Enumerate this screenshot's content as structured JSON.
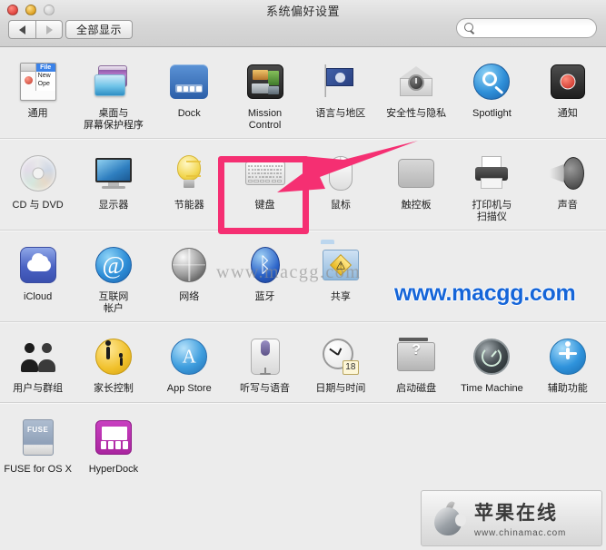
{
  "window": {
    "title": "系统偏好设置",
    "traffic_lights": [
      "close",
      "minimize",
      "zoom"
    ]
  },
  "toolbar": {
    "back_label": "◀",
    "forward_label": "▶",
    "show_all_label": "全部显示",
    "search": {
      "value": "",
      "placeholder": "",
      "icon": "search-icon"
    }
  },
  "rows": [
    {
      "cells": [
        {
          "label": "通用",
          "icon": "general-icon"
        },
        {
          "label": "桌面与\n屏幕保护程序",
          "icon": "desktop-screensaver-icon"
        },
        {
          "label": "Dock",
          "icon": "dock-icon"
        },
        {
          "label": "Mission\nControl",
          "icon": "mission-control-icon"
        },
        {
          "label": "语言与地区",
          "icon": "language-region-icon"
        },
        {
          "label": "安全性与隐私",
          "icon": "security-privacy-icon"
        },
        {
          "label": "Spotlight",
          "icon": "spotlight-icon"
        },
        {
          "label": "通知",
          "icon": "notifications-icon"
        }
      ]
    },
    {
      "cells": [
        {
          "label": "CD 与 DVD",
          "icon": "cd-dvd-icon"
        },
        {
          "label": "显示器",
          "icon": "displays-icon"
        },
        {
          "label": "节能器",
          "icon": "energy-saver-icon"
        },
        {
          "label": "键盘",
          "icon": "keyboard-icon"
        },
        {
          "label": "鼠标",
          "icon": "mouse-icon"
        },
        {
          "label": "触控板",
          "icon": "trackpad-icon"
        },
        {
          "label": "打印机与\n扫描仪",
          "icon": "printers-scanners-icon"
        },
        {
          "label": "声音",
          "icon": "sound-icon"
        }
      ]
    },
    {
      "cells": [
        {
          "label": "iCloud",
          "icon": "icloud-icon"
        },
        {
          "label": "互联网\n帐户",
          "icon": "internet-accounts-icon"
        },
        {
          "label": "网络",
          "icon": "network-icon"
        },
        {
          "label": "蓝牙",
          "icon": "bluetooth-icon"
        },
        {
          "label": "共享",
          "icon": "sharing-icon"
        },
        {
          "label": "",
          "icon": ""
        },
        {
          "label": "",
          "icon": ""
        },
        {
          "label": "",
          "icon": ""
        }
      ]
    },
    {
      "cells": [
        {
          "label": "用户与群组",
          "icon": "users-groups-icon"
        },
        {
          "label": "家长控制",
          "icon": "parental-controls-icon"
        },
        {
          "label": "App Store",
          "icon": "app-store-icon"
        },
        {
          "label": "听写与语音",
          "icon": "dictation-speech-icon"
        },
        {
          "label": "日期与时间",
          "icon": "date-time-icon"
        },
        {
          "label": "启动磁盘",
          "icon": "startup-disk-icon"
        },
        {
          "label": "Time Machine",
          "icon": "time-machine-icon"
        },
        {
          "label": "辅助功能",
          "icon": "accessibility-icon"
        }
      ]
    },
    {
      "cells": [
        {
          "label": "FUSE for OS X",
          "icon": "fuse-icon"
        },
        {
          "label": "HyperDock",
          "icon": "hyperdock-icon"
        },
        {
          "label": "",
          "icon": ""
        },
        {
          "label": "",
          "icon": ""
        },
        {
          "label": "",
          "icon": ""
        },
        {
          "label": "",
          "icon": ""
        },
        {
          "label": "",
          "icon": ""
        },
        {
          "label": "",
          "icon": ""
        }
      ]
    }
  ],
  "icon_text": {
    "general_menu_title": "File",
    "general_menu_item1": "New",
    "general_menu_item2": "Ope",
    "at_symbol": "@",
    "bluetooth_glyph": "ᛒ",
    "sharing_glyph": "⚠",
    "app_store_glyph": "A",
    "calendar_day": "18",
    "disk_glyph": "?",
    "fuse_text": "FUSE"
  },
  "annotations": {
    "highlight_target": "键盘",
    "highlight_color": "#f52f72",
    "arrow_color": "#f52f72",
    "watermark_gray": "www.macgg.com",
    "watermark_blue": "www.macgg.com",
    "watermark_blue_color": "#1565d8"
  },
  "badge": {
    "cn_title": "苹果在线",
    "url": "www.chinamac.com"
  }
}
